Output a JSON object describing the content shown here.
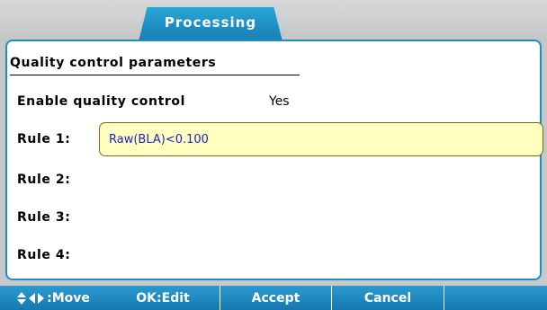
{
  "tab": {
    "label": "Processing"
  },
  "panel": {
    "section_title": "Quality control parameters",
    "enable": {
      "label": "Enable quality control",
      "value": "Yes"
    },
    "rules": [
      {
        "label": "Rule 1:",
        "value": "Raw(BLA)<0.100"
      },
      {
        "label": "Rule 2:",
        "value": ""
      },
      {
        "label": "Rule 3:",
        "value": ""
      },
      {
        "label": "Rule 4:",
        "value": ""
      }
    ]
  },
  "bottombar": {
    "move_label": ":Move",
    "edit_label": "OK:Edit",
    "accept_label": "Accept",
    "cancel_label": "Cancel"
  },
  "colors": {
    "accent": "#1d8fc4",
    "field_bg": "#ffffc0",
    "field_text": "#2020c0"
  }
}
